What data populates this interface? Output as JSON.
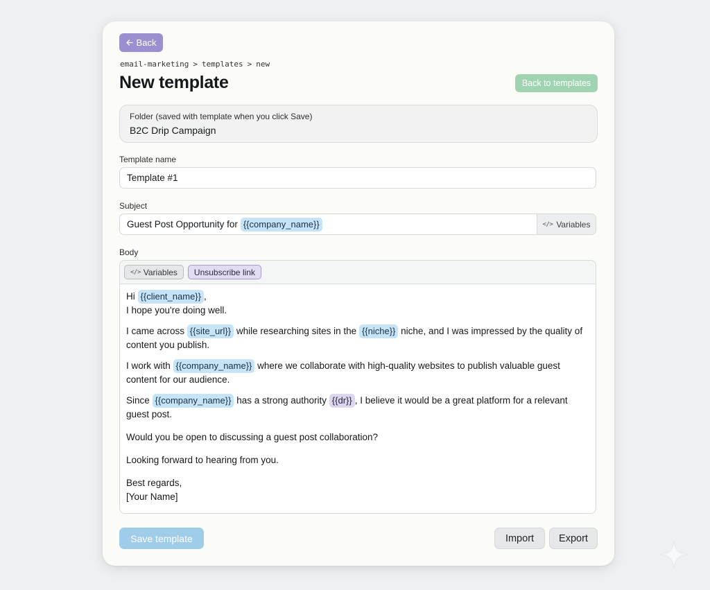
{
  "header": {
    "back_label": "Back",
    "breadcrumb": [
      "email-marketing",
      ">",
      "templates",
      ">",
      "new"
    ],
    "title": "New template",
    "back_to_templates_label": "Back to templates"
  },
  "folder": {
    "label": "Folder (saved with template when you click Save)",
    "value": "B2C Drip Campaign"
  },
  "template_name": {
    "label": "Template name",
    "value": "Template #1"
  },
  "subject": {
    "label": "Subject",
    "text": "Guest Post Opportunity for",
    "variable": "{{company_name}}",
    "variables_button": "Variables"
  },
  "body": {
    "label": "Body",
    "toolbar": {
      "variables_label": "Variables",
      "unsubscribe_label": "Unsubscribe link"
    },
    "greeting_hi": "Hi",
    "greeting_var": "{{client_name}}",
    "greeting_comma": ",",
    "line_hope": "I hope you're doing well.",
    "p2_a": "I came across",
    "p2_var1": "{{site_url}}",
    "p2_b": "while researching sites in the",
    "p2_var2": "{{niche}}",
    "p2_c": "niche, and I was impressed by the quality of content you publish.",
    "p3_a": "I work with",
    "p3_var": "{{company_name}}",
    "p3_b": "where we collaborate with high-quality websites to publish valuable guest content for our audience.",
    "p4_a": "Since",
    "p4_var1": "{{company_name}}",
    "p4_b": "has a strong authority",
    "p4_var2": "{{dr}}",
    "p4_c": ", I believe it would be a great platform for a relevant guest post.",
    "p5": "Would you be open to discussing a guest post collaboration?",
    "p6": "Looking forward to hearing from you.",
    "sign_1": "Best regards,",
    "sign_2": "[Your Name]"
  },
  "footer": {
    "save_label": "Save template",
    "import_label": "Import",
    "export_label": "Export"
  },
  "colors": {
    "back_button": "#9c8fd0",
    "back_to_templates_button": "#9fd3b1",
    "save_button": "#9fcde9",
    "variable_chip": "#c7e4f6",
    "special_chip": "#ddd6ee"
  }
}
